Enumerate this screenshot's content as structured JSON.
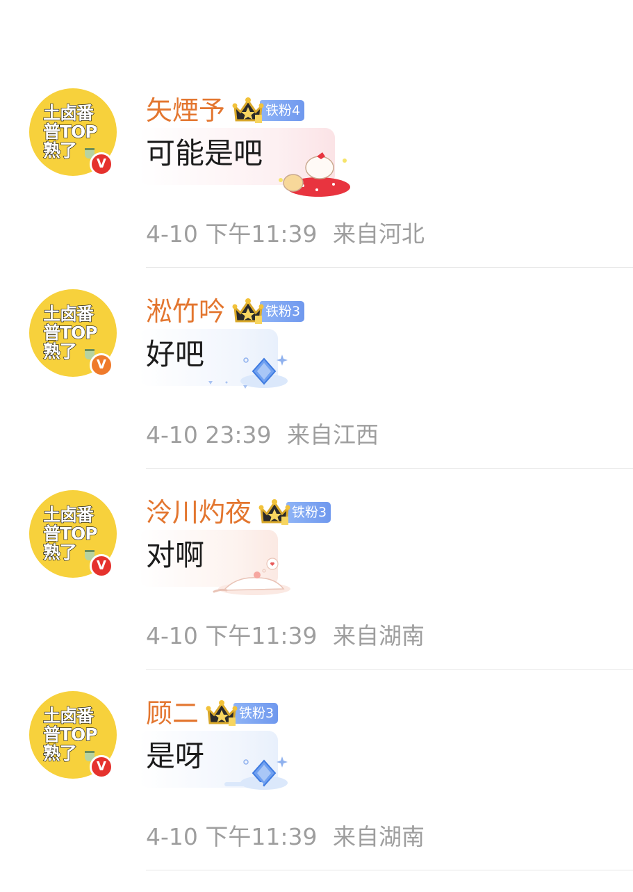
{
  "comments": [
    {
      "avatar_text": "土卤番\n普TOP\n熟了",
      "username": "矢煙予",
      "fan_badge": "铁粉4",
      "message": "可能是吧",
      "timestamp": "4-10 下午11:39",
      "location": "来自河北",
      "verified_badge": "V",
      "verified_color": "#e5322d",
      "sticker": "hello-kitty-strawberry-sticker"
    },
    {
      "avatar_text": "土卤番\n普TOP\n熟了",
      "username": "淞竹吟",
      "fan_badge": "铁粉3",
      "message": "好吧",
      "timestamp": "4-10 23:39",
      "location": "来自江西",
      "verified_badge": "V",
      "verified_color": "#ef7a2b",
      "sticker": "blue-diamond-sticker"
    },
    {
      "avatar_text": "土卤番\n普TOP\n熟了",
      "username": "泠川灼夜",
      "fan_badge": "铁粉3",
      "message": "对啊",
      "timestamp": "4-10 下午11:39",
      "location": "来自湖南",
      "verified_badge": "V",
      "verified_color": "#e5322d",
      "sticker": "sleeping-cat-sticker"
    },
    {
      "avatar_text": "土卤番\n普TOP\n熟了",
      "username": "顾二",
      "fan_badge": "铁粉3",
      "message": "是呀",
      "timestamp": "4-10 下午11:39",
      "location": "来自湖南",
      "verified_badge": "V",
      "verified_color": "#e5322d",
      "sticker": "blue-diamond-sticker"
    }
  ],
  "colors": {
    "username": "#e3762f",
    "meta_text": "#9e9e9e",
    "message_text": "#1c1c1c",
    "avatar_bg": "#f7d13c",
    "fan_badge": "#7aa2f2"
  }
}
